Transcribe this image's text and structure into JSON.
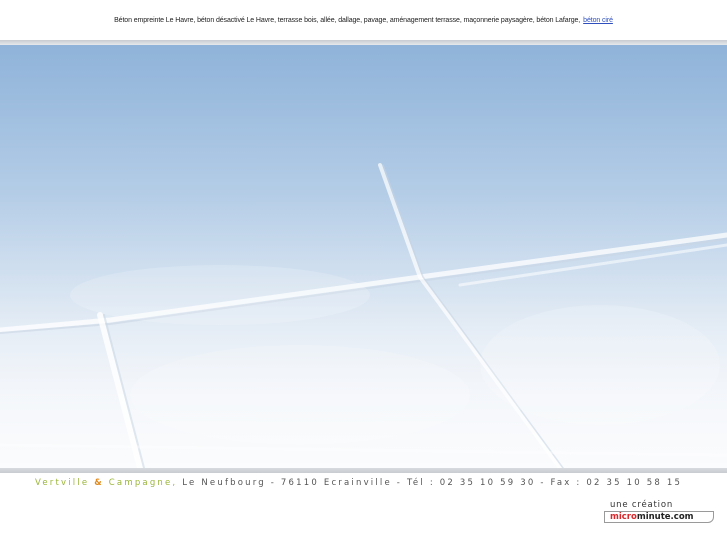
{
  "header": {
    "seo_text": "Béton empreinte Le Havre, béton désactivé Le Havre, terrasse bois, allée, dallage, pavage, aménagement terrasse, maçonnerie paysagère, béton Lafarge,",
    "link_text": "béton ciré"
  },
  "footer": {
    "brand_part1": "Vertville",
    "brand_amp": "&",
    "brand_part2": "Campagne,",
    "address_text": " Le Neufbourg - 76110 Ecrainville - Tél : 02 35 10 59 30 - Fax : 02 35 10 58 15",
    "credit_label": "une création",
    "credit_brand_part1": "micro",
    "credit_brand_part2": "minute.com"
  },
  "colors": {
    "link": "#2f4fbf",
    "brand_green": "#9ab63a",
    "brand_orange": "#e08a1c",
    "credit_red": "#d9262a",
    "sky_top": "#8fb3d9",
    "sky_bottom": "#eef2f7"
  }
}
